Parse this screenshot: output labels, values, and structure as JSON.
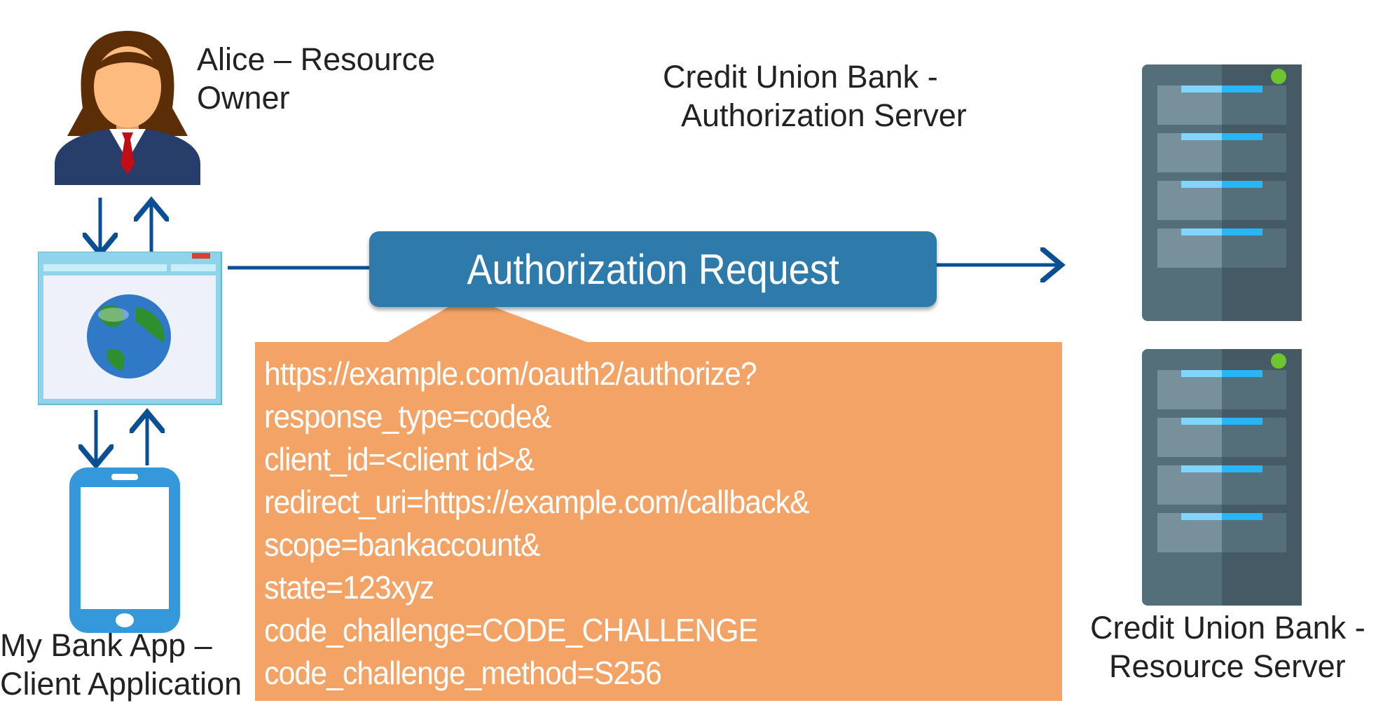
{
  "resource_owner": {
    "label_line1": "Alice – Resource",
    "label_line2": "Owner",
    "icon": "woman-user-icon"
  },
  "client_app": {
    "label_line1": "My Bank App –",
    "label_line2": "Client Application",
    "icons": [
      "browser-globe-icon",
      "smartphone-icon"
    ]
  },
  "auth_server": {
    "label_line1": "Credit Union  Bank -",
    "label_line2": "Authorization Server",
    "icon": "server-icon"
  },
  "resource_server": {
    "label_line1": "Credit Union  Bank -",
    "label_line2": "Resource Server",
    "icon": "server-icon"
  },
  "request": {
    "title": "Authorization Request",
    "lines": [
      "https://example.com/oauth2/authorize?",
      "response_type=code&",
      "client_id=<client id>&",
      "redirect_uri=https://example.com/callback&",
      "scope=bankaccount&",
      "state=123xyz",
      "code_challenge=CODE_CHALLENGE",
      "code_challenge_method=S256"
    ]
  },
  "colors": {
    "arrow": "#0a4f94",
    "request_box": "#2e7aab",
    "callout": "#f3a366",
    "server": "#546e7a"
  }
}
